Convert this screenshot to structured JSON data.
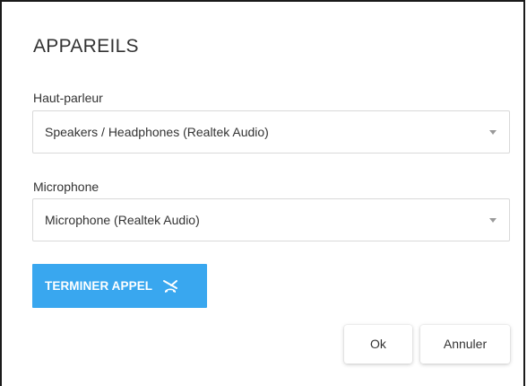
{
  "dialog": {
    "title": "APPAREILS"
  },
  "speaker": {
    "label": "Haut-parleur",
    "selected": "Speakers / Headphones (Realtek Audio)"
  },
  "microphone": {
    "label": "Microphone",
    "selected": "Microphone (Realtek Audio)"
  },
  "end_call": {
    "label": "TERMINER APPEL",
    "icon": "call-end-icon",
    "color": "#39a7ef"
  },
  "actions": {
    "ok_label": "Ok",
    "cancel_label": "Annuler"
  }
}
